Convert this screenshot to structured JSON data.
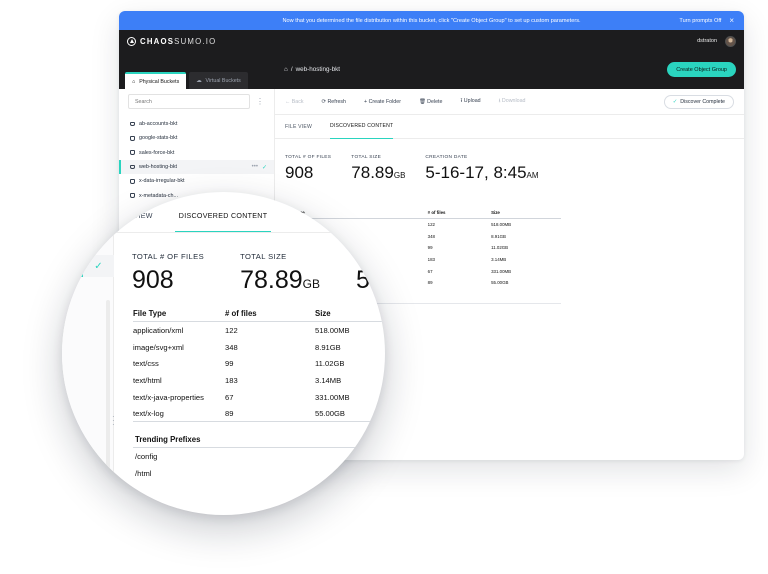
{
  "banner": {
    "message": "Now that you determined the file distribution within this bucket, click \"Create Object Group\" to set up custom parameters.",
    "turn_off": "Turn prompts Off",
    "close": "×"
  },
  "brand": {
    "bold": "CHAOS",
    "thin": "SUMO.IO"
  },
  "user": {
    "name": "dstraton"
  },
  "bucket_tabs": [
    "Physical Buckets",
    "Virtual Buckets"
  ],
  "breadcrumb": {
    "home_icon": "home-icon",
    "sep": "/",
    "current": "web-hosting-bkt"
  },
  "create_button": "Create Object Group",
  "search": {
    "placeholder": "Search"
  },
  "buckets": [
    "ab-accounts-bkt",
    "google-stats-bkt",
    "sales-force-bkt",
    "web-hosting-bkt",
    "x-data-irregular-bkt",
    "x-metadata-ch..."
  ],
  "selected_bucket_actions": {
    "more": "•••",
    "check": "✓"
  },
  "toolbar": {
    "back": "← Back",
    "refresh": "⟳ Refresh",
    "create_folder": "+ Create Folder",
    "delete": "🗑 Delete",
    "upload": "⭱ Upload",
    "download": "⭳ Download",
    "discover": "Discover Complete",
    "discover_check": "✓"
  },
  "view_tabs": [
    "FILE VIEW",
    "DISCOVERED CONTENT"
  ],
  "stats": {
    "files_label": "TOTAL # OF FILES",
    "files_value": "908",
    "size_label": "TOTAL SIZE",
    "size_value": "78.89",
    "size_unit": "GB",
    "date_label": "CREATION DATE",
    "date_value": "5-16-17, 8:45",
    "date_suffix": "AM"
  },
  "file_table": {
    "headers": [
      "File Type",
      "# of files",
      "Size"
    ],
    "rows": [
      [
        "application/xml",
        "122",
        "518.00MB"
      ],
      [
        "image/svg+xml",
        "348",
        "8.91GB"
      ],
      [
        "text/css",
        "99",
        "11.02GB"
      ],
      [
        "text/html",
        "183",
        "3.14MB"
      ],
      [
        "text/x-java-properties",
        "67",
        "331.00MB"
      ],
      [
        "text/x-log",
        "89",
        "55.00GB"
      ]
    ]
  },
  "trending": {
    "title": "Trending Prefixes",
    "prefixes": [
      "/config",
      "/html"
    ]
  },
  "colors": {
    "accent": "#2ad4bf",
    "banner": "#3d7ff7",
    "dark": "#1c1c1e"
  }
}
